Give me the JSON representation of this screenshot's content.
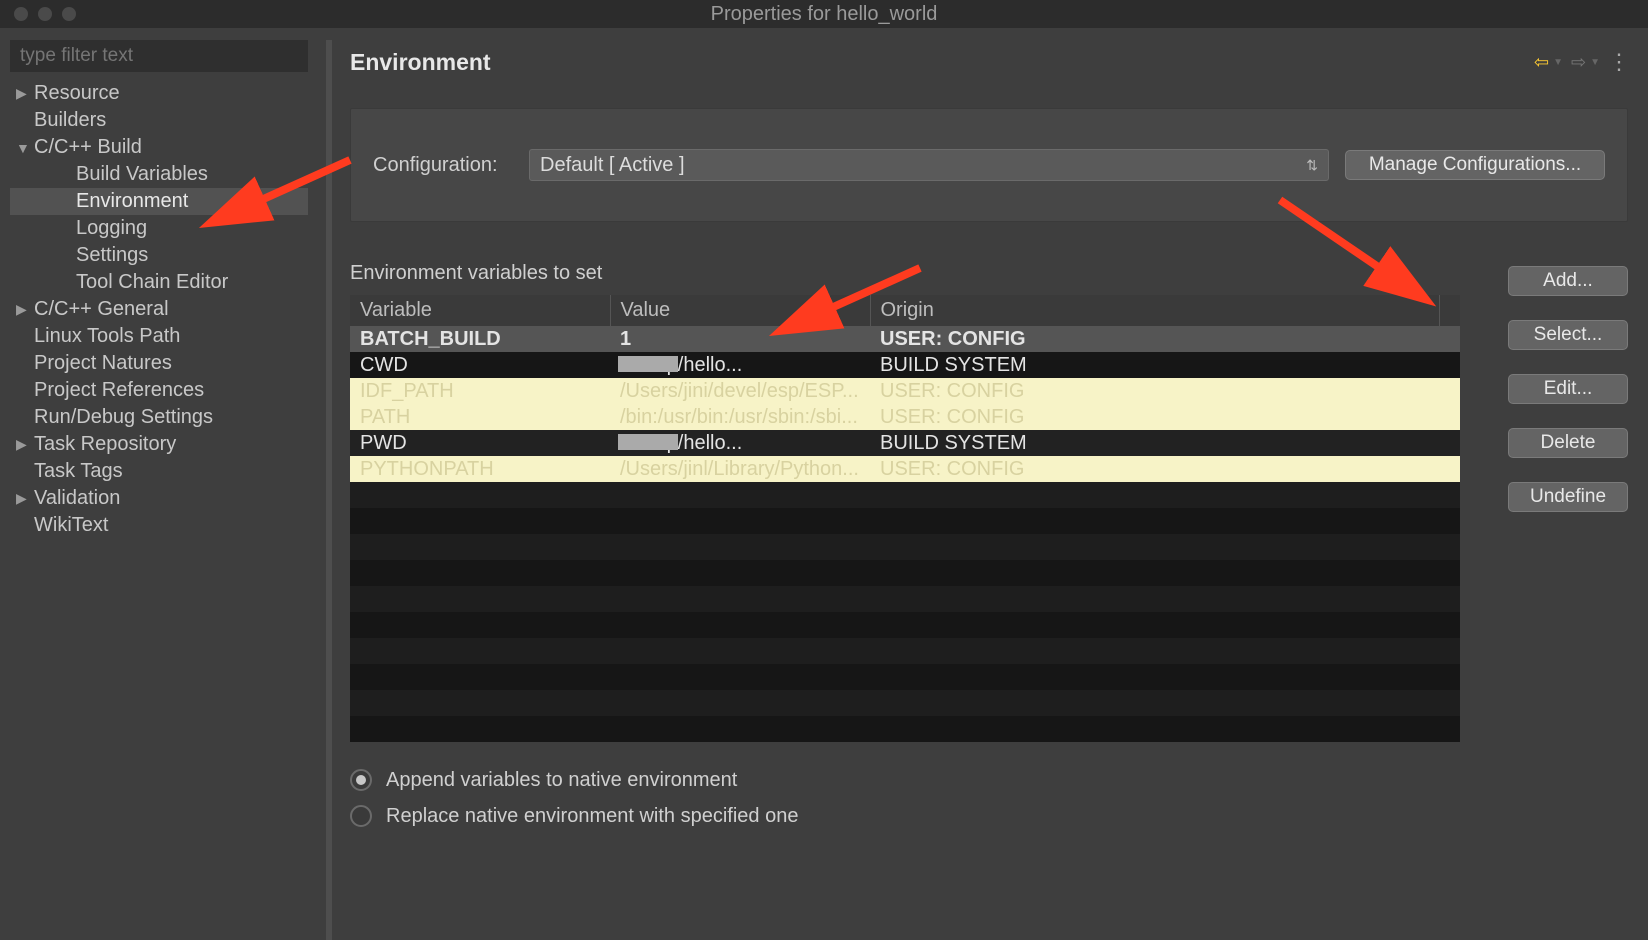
{
  "window": {
    "title": "Properties for hello_world"
  },
  "sidebar": {
    "filter_placeholder": "type filter text",
    "items": [
      {
        "label": "Resource",
        "level": 0,
        "arrow": "right"
      },
      {
        "label": "Builders",
        "level": 0,
        "arrow": "none"
      },
      {
        "label": "C/C++ Build",
        "level": 0,
        "arrow": "down"
      },
      {
        "label": "Build Variables",
        "level": 1,
        "arrow": "none"
      },
      {
        "label": "Environment",
        "level": 1,
        "arrow": "none",
        "selected": true
      },
      {
        "label": "Logging",
        "level": 1,
        "arrow": "none"
      },
      {
        "label": "Settings",
        "level": 1,
        "arrow": "none"
      },
      {
        "label": "Tool Chain Editor",
        "level": 1,
        "arrow": "none"
      },
      {
        "label": "C/C++ General",
        "level": 0,
        "arrow": "right"
      },
      {
        "label": "Linux Tools Path",
        "level": 0,
        "arrow": "none"
      },
      {
        "label": "Project Natures",
        "level": 0,
        "arrow": "none"
      },
      {
        "label": "Project References",
        "level": 0,
        "arrow": "none"
      },
      {
        "label": "Run/Debug Settings",
        "level": 0,
        "arrow": "none"
      },
      {
        "label": "Task Repository",
        "level": 0,
        "arrow": "right"
      },
      {
        "label": "Task Tags",
        "level": 0,
        "arrow": "none"
      },
      {
        "label": "Validation",
        "level": 0,
        "arrow": "right"
      },
      {
        "label": "WikiText",
        "level": 0,
        "arrow": "none"
      }
    ]
  },
  "main": {
    "title": "Environment",
    "config": {
      "label": "Configuration:",
      "selected": "Default  [ Active ]",
      "manage_btn": "Manage Configurations..."
    },
    "section_label": "Environment variables to set",
    "columns": [
      "Variable",
      "Value",
      "Origin"
    ],
    "rows": [
      {
        "variable": "BATCH_BUILD",
        "value": "1",
        "origin": "USER: CONFIG",
        "style": "sel"
      },
      {
        "variable": "CWD",
        "value": "… esp/hello...",
        "origin": "BUILD SYSTEM",
        "style": "dark",
        "redacted": true
      },
      {
        "variable": "IDF_PATH",
        "value": "/Users/jini/devel/esp/ESP...",
        "origin": "USER: CONFIG",
        "style": "hl"
      },
      {
        "variable": "PATH",
        "value": "/bin:/usr/bin:/usr/sbin:/sbi...",
        "origin": "USER: CONFIG",
        "style": "hl"
      },
      {
        "variable": "PWD",
        "value": "… esp/hello...",
        "origin": "BUILD SYSTEM",
        "style": "dark",
        "redacted": true
      },
      {
        "variable": "PYTHONPATH",
        "value": "/Users/jinl/Library/Python...",
        "origin": "USER: CONFIG",
        "style": "hl"
      }
    ],
    "buttons": {
      "add": "Add...",
      "select": "Select...",
      "edit": "Edit...",
      "delete": "Delete",
      "undefine": "Undefine"
    },
    "radios": {
      "append": "Append variables to native environment",
      "replace": "Replace native environment with specified one"
    }
  }
}
